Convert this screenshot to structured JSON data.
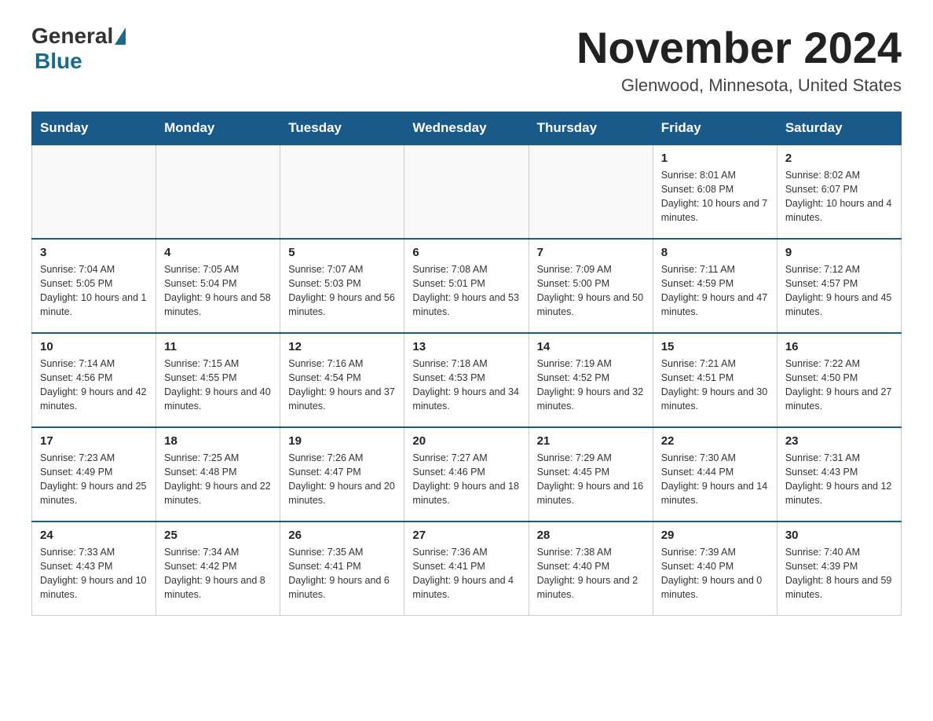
{
  "header": {
    "logo_general": "General",
    "logo_blue": "Blue",
    "month_title": "November 2024",
    "location": "Glenwood, Minnesota, United States"
  },
  "days_of_week": [
    "Sunday",
    "Monday",
    "Tuesday",
    "Wednesday",
    "Thursday",
    "Friday",
    "Saturday"
  ],
  "weeks": [
    [
      {
        "day": "",
        "info": ""
      },
      {
        "day": "",
        "info": ""
      },
      {
        "day": "",
        "info": ""
      },
      {
        "day": "",
        "info": ""
      },
      {
        "day": "",
        "info": ""
      },
      {
        "day": "1",
        "info": "Sunrise: 8:01 AM\nSunset: 6:08 PM\nDaylight: 10 hours and 7 minutes."
      },
      {
        "day": "2",
        "info": "Sunrise: 8:02 AM\nSunset: 6:07 PM\nDaylight: 10 hours and 4 minutes."
      }
    ],
    [
      {
        "day": "3",
        "info": "Sunrise: 7:04 AM\nSunset: 5:05 PM\nDaylight: 10 hours and 1 minute."
      },
      {
        "day": "4",
        "info": "Sunrise: 7:05 AM\nSunset: 5:04 PM\nDaylight: 9 hours and 58 minutes."
      },
      {
        "day": "5",
        "info": "Sunrise: 7:07 AM\nSunset: 5:03 PM\nDaylight: 9 hours and 56 minutes."
      },
      {
        "day": "6",
        "info": "Sunrise: 7:08 AM\nSunset: 5:01 PM\nDaylight: 9 hours and 53 minutes."
      },
      {
        "day": "7",
        "info": "Sunrise: 7:09 AM\nSunset: 5:00 PM\nDaylight: 9 hours and 50 minutes."
      },
      {
        "day": "8",
        "info": "Sunrise: 7:11 AM\nSunset: 4:59 PM\nDaylight: 9 hours and 47 minutes."
      },
      {
        "day": "9",
        "info": "Sunrise: 7:12 AM\nSunset: 4:57 PM\nDaylight: 9 hours and 45 minutes."
      }
    ],
    [
      {
        "day": "10",
        "info": "Sunrise: 7:14 AM\nSunset: 4:56 PM\nDaylight: 9 hours and 42 minutes."
      },
      {
        "day": "11",
        "info": "Sunrise: 7:15 AM\nSunset: 4:55 PM\nDaylight: 9 hours and 40 minutes."
      },
      {
        "day": "12",
        "info": "Sunrise: 7:16 AM\nSunset: 4:54 PM\nDaylight: 9 hours and 37 minutes."
      },
      {
        "day": "13",
        "info": "Sunrise: 7:18 AM\nSunset: 4:53 PM\nDaylight: 9 hours and 34 minutes."
      },
      {
        "day": "14",
        "info": "Sunrise: 7:19 AM\nSunset: 4:52 PM\nDaylight: 9 hours and 32 minutes."
      },
      {
        "day": "15",
        "info": "Sunrise: 7:21 AM\nSunset: 4:51 PM\nDaylight: 9 hours and 30 minutes."
      },
      {
        "day": "16",
        "info": "Sunrise: 7:22 AM\nSunset: 4:50 PM\nDaylight: 9 hours and 27 minutes."
      }
    ],
    [
      {
        "day": "17",
        "info": "Sunrise: 7:23 AM\nSunset: 4:49 PM\nDaylight: 9 hours and 25 minutes."
      },
      {
        "day": "18",
        "info": "Sunrise: 7:25 AM\nSunset: 4:48 PM\nDaylight: 9 hours and 22 minutes."
      },
      {
        "day": "19",
        "info": "Sunrise: 7:26 AM\nSunset: 4:47 PM\nDaylight: 9 hours and 20 minutes."
      },
      {
        "day": "20",
        "info": "Sunrise: 7:27 AM\nSunset: 4:46 PM\nDaylight: 9 hours and 18 minutes."
      },
      {
        "day": "21",
        "info": "Sunrise: 7:29 AM\nSunset: 4:45 PM\nDaylight: 9 hours and 16 minutes."
      },
      {
        "day": "22",
        "info": "Sunrise: 7:30 AM\nSunset: 4:44 PM\nDaylight: 9 hours and 14 minutes."
      },
      {
        "day": "23",
        "info": "Sunrise: 7:31 AM\nSunset: 4:43 PM\nDaylight: 9 hours and 12 minutes."
      }
    ],
    [
      {
        "day": "24",
        "info": "Sunrise: 7:33 AM\nSunset: 4:43 PM\nDaylight: 9 hours and 10 minutes."
      },
      {
        "day": "25",
        "info": "Sunrise: 7:34 AM\nSunset: 4:42 PM\nDaylight: 9 hours and 8 minutes."
      },
      {
        "day": "26",
        "info": "Sunrise: 7:35 AM\nSunset: 4:41 PM\nDaylight: 9 hours and 6 minutes."
      },
      {
        "day": "27",
        "info": "Sunrise: 7:36 AM\nSunset: 4:41 PM\nDaylight: 9 hours and 4 minutes."
      },
      {
        "day": "28",
        "info": "Sunrise: 7:38 AM\nSunset: 4:40 PM\nDaylight: 9 hours and 2 minutes."
      },
      {
        "day": "29",
        "info": "Sunrise: 7:39 AM\nSunset: 4:40 PM\nDaylight: 9 hours and 0 minutes."
      },
      {
        "day": "30",
        "info": "Sunrise: 7:40 AM\nSunset: 4:39 PM\nDaylight: 8 hours and 59 minutes."
      }
    ]
  ]
}
